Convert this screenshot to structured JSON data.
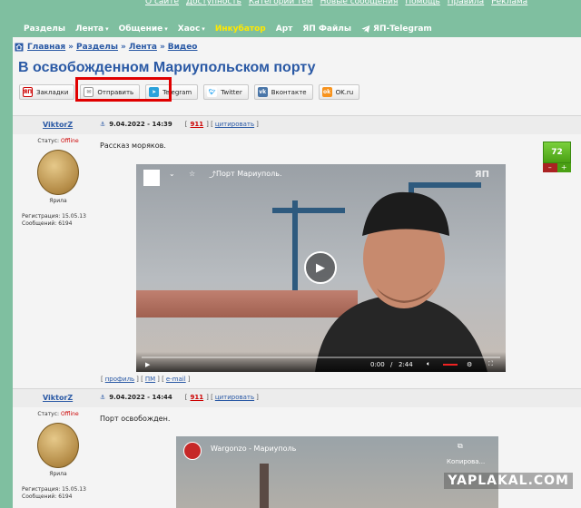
{
  "top_links": [
    "О сайте",
    "Доступность",
    "Категории тем",
    "Новые сообщения",
    "Помощь",
    "Правила",
    "Рекламa"
  ],
  "nav": {
    "items": [
      {
        "label": "Разделы",
        "dropdown": false
      },
      {
        "label": "Лента",
        "dropdown": true
      },
      {
        "label": "Общение",
        "dropdown": true
      },
      {
        "label": "Хаос",
        "dropdown": true
      },
      {
        "label": "Инкубатор",
        "dropdown": false
      },
      {
        "label": "Арт",
        "dropdown": false
      },
      {
        "label": "ЯП Файлы",
        "dropdown": false
      },
      {
        "label": "ЯП-Telegram",
        "dropdown": false
      }
    ]
  },
  "breadcrumb": [
    "Главная",
    "Разделы",
    "Лента",
    "Видео"
  ],
  "page_title": "В освобожденном Мариупольском порту",
  "share": [
    "Закладки",
    "Отправить",
    "Telegram",
    "Twitter",
    "Вконтакте",
    "OK.ru"
  ],
  "posts": [
    {
      "author": "ViktorZ",
      "date": "9.04.2022 - 14:39",
      "post_num": "911",
      "cite": "цитировать",
      "status_label": "Статус:",
      "status_value": "Offline",
      "rank": "Ярила",
      "reg": "Регистрация: 15.05.13",
      "msgs": "Сообщений: 6194",
      "text": "Рассказ моряков.",
      "video_title": "Порт Мариуполь.",
      "video_time": "0:00",
      "video_sep": "/",
      "video_duration": "2:44",
      "video_watermark": "ЯП",
      "rating": "72",
      "rating_minus": "–",
      "rating_plus": "+",
      "footer": [
        "профиль",
        "ПМ",
        "e-mail"
      ]
    },
    {
      "author": "ViktorZ",
      "date": "9.04.2022 - 14:44",
      "post_num": "911",
      "cite": "цитировать",
      "status_label": "Статус:",
      "status_value": "Offline",
      "rank": "Ярила",
      "reg": "Регистрация: 15.05.13",
      "msgs": "Сообщений: 6194",
      "text": "Порт освобожден.",
      "video_title": "Wargonzo - Мариуполь",
      "video_copy": "Копирова..."
    }
  ],
  "site_watermark": "YAPLAKAL.COM",
  "colors": {
    "link": "#2a59a5",
    "highlight": "#e00000",
    "rating": "#4aa014",
    "bg": "#7fbfa0"
  }
}
